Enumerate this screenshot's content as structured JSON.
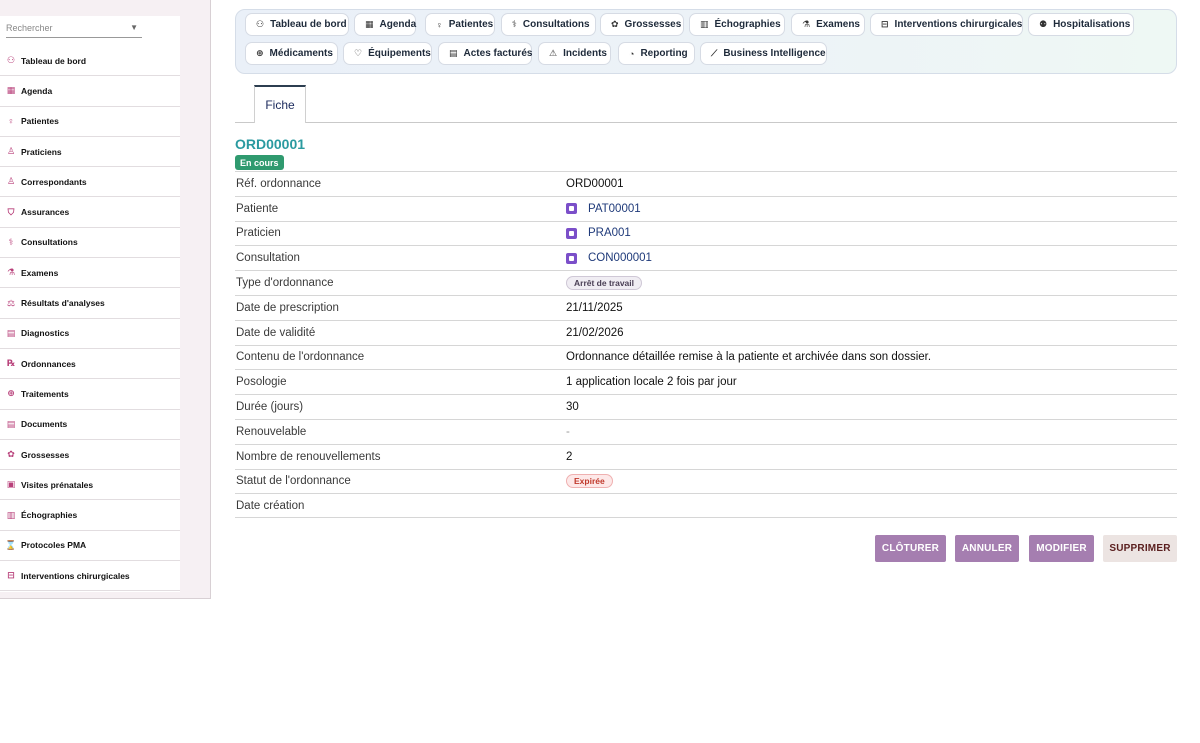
{
  "sidebar": {
    "search_placeholder": "Rechercher",
    "items": [
      {
        "label": "Tableau de bord",
        "icon": "dashboard-icon",
        "glyph": "⚇"
      },
      {
        "label": "Agenda",
        "icon": "calendar-icon",
        "glyph": "▦"
      },
      {
        "label": "Patientes",
        "icon": "female-icon",
        "glyph": "♀"
      },
      {
        "label": "Praticiens",
        "icon": "doctor-icon",
        "glyph": "♙"
      },
      {
        "label": "Correspondants",
        "icon": "user-icon",
        "glyph": "♙"
      },
      {
        "label": "Assurances",
        "icon": "shield-icon",
        "glyph": "⛉"
      },
      {
        "label": "Consultations",
        "icon": "stethoscope-icon",
        "glyph": "⚕"
      },
      {
        "label": "Examens",
        "icon": "microscope-icon",
        "glyph": "⚗"
      },
      {
        "label": "Résultats d'analyses",
        "icon": "lab-results-icon",
        "glyph": "⚖"
      },
      {
        "label": "Diagnostics",
        "icon": "clipboard-icon",
        "glyph": "▤"
      },
      {
        "label": "Ordonnances",
        "icon": "prescription-icon",
        "glyph": "℞"
      },
      {
        "label": "Traitements",
        "icon": "pills-icon",
        "glyph": "⊕"
      },
      {
        "label": "Documents",
        "icon": "document-icon",
        "glyph": "▤"
      },
      {
        "label": "Grossesses",
        "icon": "pregnancy-icon",
        "glyph": "✿"
      },
      {
        "label": "Visites prénatales",
        "icon": "prenatal-icon",
        "glyph": "▣"
      },
      {
        "label": "Échographies",
        "icon": "ultrasound-icon",
        "glyph": "▥"
      },
      {
        "label": "Protocoles PMA",
        "icon": "hourglass-icon",
        "glyph": "⌛"
      },
      {
        "label": "Interventions chirurgicales",
        "icon": "bed-icon",
        "glyph": "⊟"
      }
    ]
  },
  "topnav": {
    "items": [
      {
        "label": "Tableau de bord",
        "icon": "dashboard-icon",
        "glyph": "⚇"
      },
      {
        "label": "Agenda",
        "icon": "calendar-icon",
        "glyph": "▦"
      },
      {
        "label": "Patientes",
        "icon": "female-icon",
        "glyph": "♀"
      },
      {
        "label": "Consultations",
        "icon": "stethoscope-icon",
        "glyph": "⚕"
      },
      {
        "label": "Grossesses",
        "icon": "pregnancy-icon",
        "glyph": "✿"
      },
      {
        "label": "Échographies",
        "icon": "ultrasound-icon",
        "glyph": "▥"
      },
      {
        "label": "Examens",
        "icon": "microscope-icon",
        "glyph": "⚗"
      },
      {
        "label": "Interventions chirurgicales",
        "icon": "bed-icon",
        "glyph": "⊟"
      },
      {
        "label": "Hospitalisations",
        "icon": "hospital-icon",
        "glyph": "⚉"
      },
      {
        "label": "Médicaments",
        "icon": "pills-icon",
        "glyph": "⊕"
      },
      {
        "label": "Équipements",
        "icon": "heart-icon",
        "glyph": "♡"
      },
      {
        "label": "Actes facturés",
        "icon": "invoice-icon",
        "glyph": "▤"
      },
      {
        "label": "Incidents",
        "icon": "warning-icon",
        "glyph": "⚠"
      },
      {
        "label": "Reporting",
        "icon": "pie-chart-icon",
        "glyph": "◔"
      },
      {
        "label": "Business Intelligence",
        "icon": "line-chart-icon",
        "glyph": "⟋"
      }
    ]
  },
  "tabs": {
    "active": "Fiche"
  },
  "record": {
    "title": "ORD00001",
    "status_badge": "En cours",
    "fields": [
      {
        "label": "Réf. ordonnance",
        "value": "ORD00001",
        "kind": "text"
      },
      {
        "label": "Patiente",
        "value": "PAT00001",
        "kind": "link"
      },
      {
        "label": "Praticien",
        "value": "PRA001",
        "kind": "link"
      },
      {
        "label": "Consultation",
        "value": "CON000001",
        "kind": "link"
      },
      {
        "label": "Type d'ordonnance",
        "value": "Arrêt de travail",
        "kind": "chip-neutral"
      },
      {
        "label": "Date de prescription",
        "value": "21/11/2025",
        "kind": "text"
      },
      {
        "label": "Date de validité",
        "value": "21/02/2026",
        "kind": "text"
      },
      {
        "label": "Contenu de l'ordonnance",
        "value": "Ordonnance détaillée remise à la patiente et archivée dans son dossier.",
        "kind": "text"
      },
      {
        "label": "Posologie",
        "value": "1 application locale 2 fois par jour",
        "kind": "text"
      },
      {
        "label": "Durée (jours)",
        "value": "30",
        "kind": "text"
      },
      {
        "label": "Renouvelable",
        "value": "-",
        "kind": "muted"
      },
      {
        "label": "Nombre de renouvellements",
        "value": "2",
        "kind": "text"
      },
      {
        "label": "Statut de l'ordonnance",
        "value": "Expirée",
        "kind": "chip-danger"
      },
      {
        "label": "Date création",
        "value": "",
        "kind": "text"
      }
    ]
  },
  "actions": {
    "close": "CLÔTURER",
    "cancel": "ANNULER",
    "edit": "MODIFIER",
    "delete": "SUPPRIMER"
  },
  "colors": {
    "accent_title": "#2a9aa0",
    "badge_green": "#2f9a6f",
    "button_purple": "#a57eb0",
    "link_blue": "#1f3a7a",
    "sidebar_icon": "#b8407a"
  }
}
